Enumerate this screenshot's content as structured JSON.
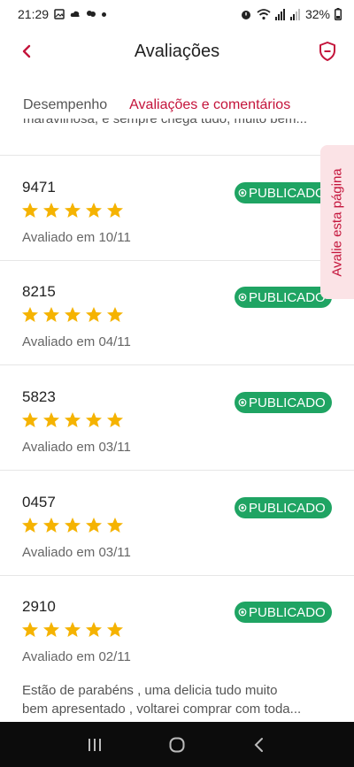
{
  "status_bar": {
    "time": "21:29",
    "battery": "32%"
  },
  "header": {
    "title": "Avaliações"
  },
  "tabs": [
    {
      "label": "Desempenho",
      "active": false
    },
    {
      "label": "Avaliações e comentários",
      "active": true
    }
  ],
  "cut_off_comment": "maravilhosa, e sempre chega tudo, muito bem...",
  "reviews": [
    {
      "order_id": "9471",
      "rating": 5,
      "date": "Avaliado em 10/11",
      "status": "PUBLICADO"
    },
    {
      "order_id": "8215",
      "rating": 5,
      "date": "Avaliado em 04/11",
      "status": "PUBLICADO"
    },
    {
      "order_id": "5823",
      "rating": 5,
      "date": "Avaliado em 03/11",
      "status": "PUBLICADO"
    },
    {
      "order_id": "0457",
      "rating": 5,
      "date": "Avaliado em 03/11",
      "status": "PUBLICADO"
    },
    {
      "order_id": "2910",
      "rating": 5,
      "date": "Avaliado em 02/11",
      "status": "PUBLICADO",
      "comment_lines": [
        "Estão de parabéns , uma delicia tudo muito",
        "bem apresentado , voltarei comprar com toda..."
      ]
    }
  ],
  "side_tab": {
    "label": "Avalie esta página"
  },
  "colors": {
    "accent": "#c4143b",
    "published": "#1fa463",
    "star": "#f5b301"
  }
}
